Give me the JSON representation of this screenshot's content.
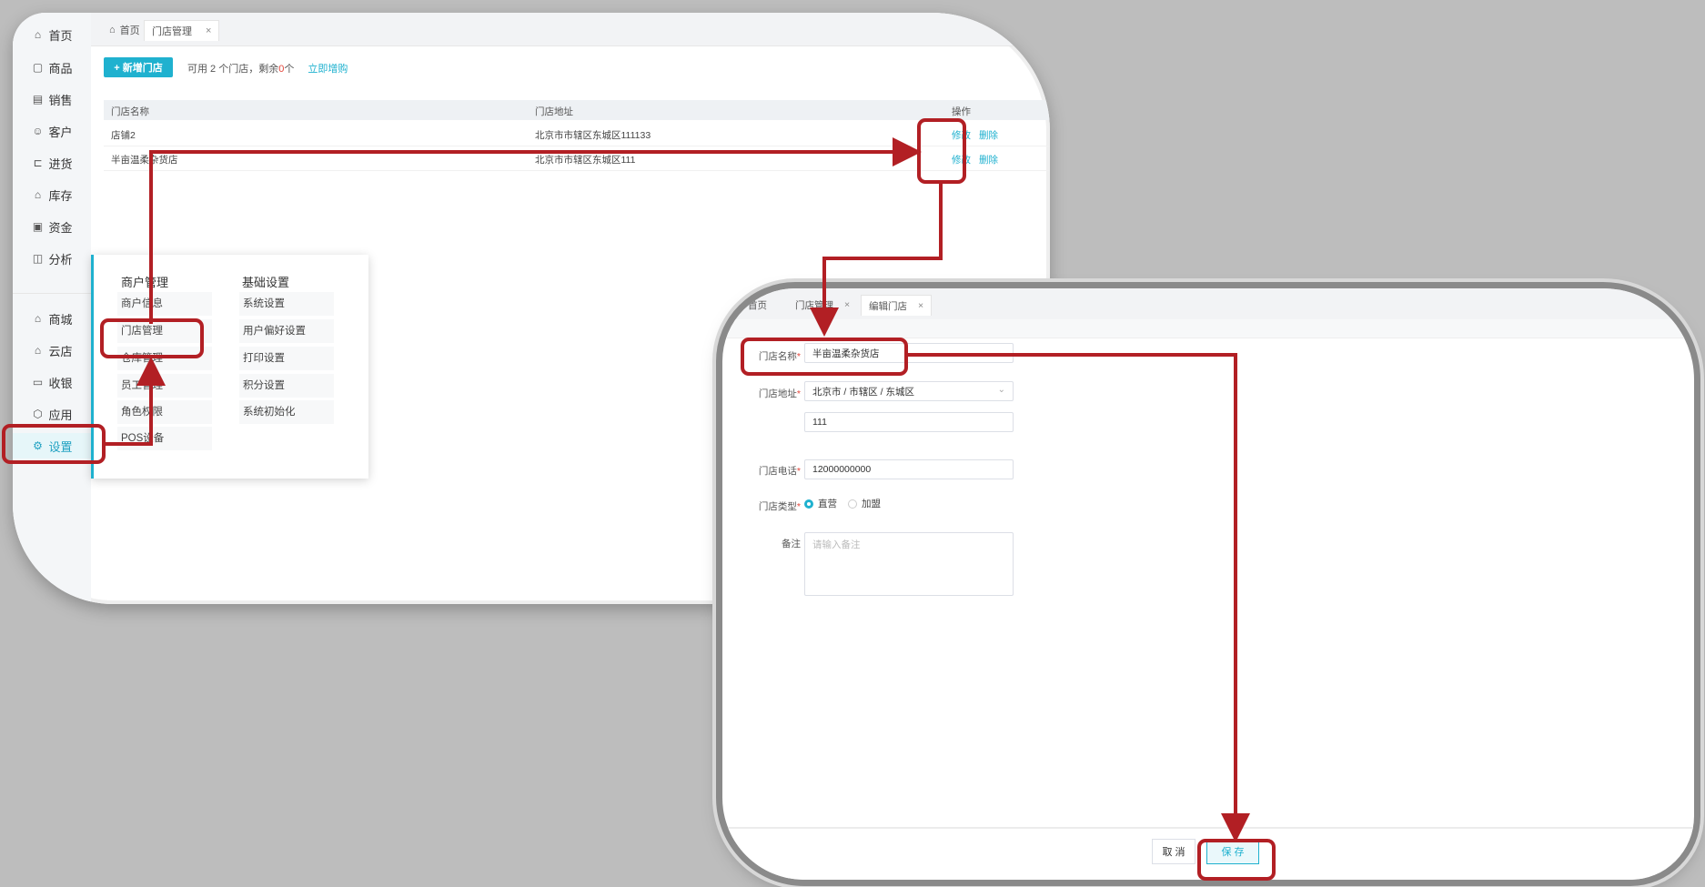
{
  "back_window": {
    "tabs": [
      {
        "label": "首页"
      },
      {
        "label": "门店管理",
        "close": "×"
      }
    ],
    "sidebar": {
      "items": [
        {
          "label": "首页",
          "icon": "home-icon"
        },
        {
          "label": "商品",
          "icon": "goods-icon"
        },
        {
          "label": "销售",
          "icon": "sales-icon"
        },
        {
          "label": "客户",
          "icon": "customer-icon"
        },
        {
          "label": "进货",
          "icon": "purchase-icon"
        },
        {
          "label": "库存",
          "icon": "inventory-icon"
        },
        {
          "label": "资金",
          "icon": "funds-icon"
        },
        {
          "label": "分析",
          "icon": "analysis-icon"
        },
        {
          "label": "商城",
          "icon": "mall-icon"
        },
        {
          "label": "云店",
          "icon": "cloud-store-icon"
        },
        {
          "label": "收银",
          "icon": "cashier-icon"
        },
        {
          "label": "应用",
          "icon": "apps-icon"
        },
        {
          "label": "设置",
          "icon": "settings-icon"
        }
      ]
    },
    "toolbar": {
      "add_button": "+ 新增门店",
      "hint_prefix": "可用 2 个门店，剩余",
      "hint_remaining": "0",
      "hint_suffix": "个",
      "buy_link": "立即增购"
    },
    "table": {
      "columns": [
        "门店名称",
        "门店地址",
        "操作"
      ],
      "rows": [
        {
          "name": "店铺2",
          "address": "北京市市辖区东城区111133",
          "edit": "修改",
          "delete": "删除"
        },
        {
          "name": "半亩温柔杂货店",
          "address": "北京市市辖区东城区111",
          "edit": "修改",
          "delete": "删除"
        }
      ]
    },
    "settings_menu": {
      "merchant_heading": "商户管理",
      "basic_heading": "基础设置",
      "merchant_items": [
        "商户信息",
        "门店管理",
        "仓库管理",
        "员工管理",
        "角色权限",
        "POS设备"
      ],
      "basic_items": [
        "系统设置",
        "用户偏好设置",
        "打印设置",
        "积分设置",
        "系统初始化"
      ]
    }
  },
  "front_window": {
    "tabs": [
      {
        "label": "首页"
      },
      {
        "label": "门店管理",
        "close": "×"
      },
      {
        "label": "编辑门店",
        "close": "×"
      }
    ],
    "form": {
      "name_label": "门店名称",
      "name_value": "半亩温柔杂货店",
      "address_label": "门店地址",
      "region_value": "北京市 / 市辖区 / 东城区",
      "detail_value": "111",
      "phone_label": "门店电话",
      "phone_value": "12000000000",
      "type_label": "门店类型",
      "type_options": [
        "直营",
        "加盟"
      ],
      "type_selected": "直营",
      "note_label": "备注",
      "note_placeholder": "请输入备注",
      "required_mark": "*"
    },
    "footer": {
      "cancel": "取 消",
      "save": "保 存"
    }
  },
  "colors": {
    "accent": "#1fb1cf",
    "annotation": "#b21f24",
    "required": "#e5463b"
  }
}
